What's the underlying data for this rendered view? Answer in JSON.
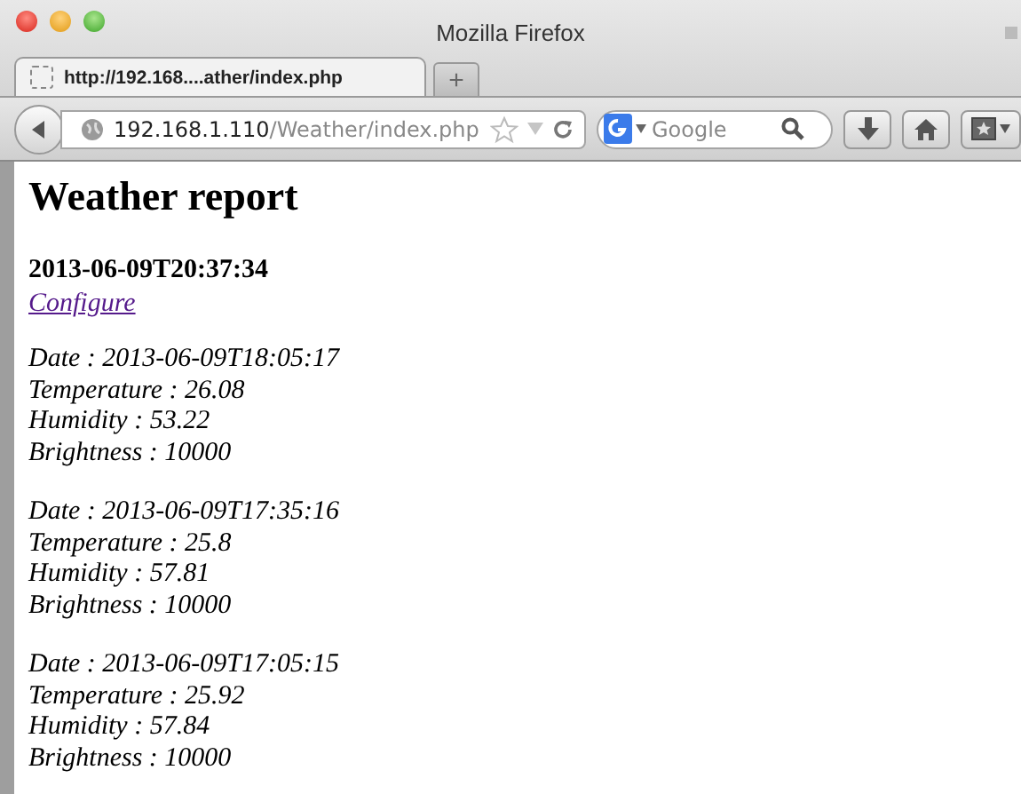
{
  "window": {
    "title": "Mozilla Firefox"
  },
  "tabs": [
    {
      "label": "http://192.168....ather/index.php",
      "selected": true
    }
  ],
  "new_tab": "+",
  "address_bar": {
    "host": "192.168.1.110",
    "path": "/Weather/index.php"
  },
  "search": {
    "placeholder": "Google"
  },
  "page": {
    "heading": "Weather report",
    "timestamp": "2013-06-09T20:37:34",
    "link": "Configure",
    "records": [
      {
        "lines": [
          "Date : 2013-06-09T18:05:17",
          "Temperature : 26.08",
          "Humidity : 53.22",
          "Brightness : 10000"
        ]
      },
      {
        "lines": [
          "Date : 2013-06-09T17:35:16",
          "Temperature : 25.8",
          "Humidity : 57.81",
          "Brightness : 10000"
        ]
      },
      {
        "lines": [
          "Date : 2013-06-09T17:05:15",
          "Temperature : 25.92",
          "Humidity : 57.84",
          "Brightness : 10000"
        ]
      }
    ]
  }
}
